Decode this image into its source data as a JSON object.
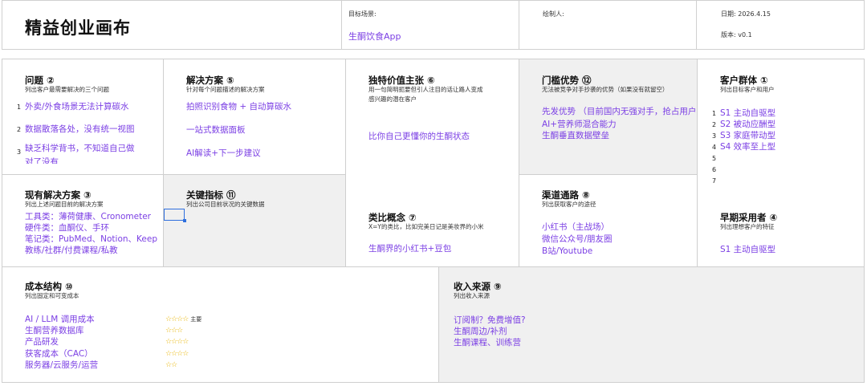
{
  "header": {
    "title": "精益创业画布",
    "target_label": "目标场景:",
    "target_value": "生酮饮食App",
    "author_label": "绘制人:",
    "date_text": "日期:  2026.4.15",
    "version_text": "版本:  v0.1"
  },
  "problem": {
    "title": "问题 ②",
    "subtitle": "列出客户最需要解决的三个问题",
    "items": [
      {
        "num": "1",
        "text": "外卖/外食场景无法计算碳水"
      },
      {
        "num": "2",
        "text": "数据散落各处，没有统一视图"
      },
      {
        "num": "3",
        "text": "缺乏科学背书，不知道自己做"
      },
      {
        "num": "",
        "text": "对了没有"
      }
    ]
  },
  "existing": {
    "title": "现有解决方案 ③",
    "subtitle": "列出上述问题目前的解决方案",
    "items": [
      "工具类：薄荷健康、Cronometer",
      "硬件类：血酮仪、手环",
      "笔记类：PubMed、Notion、Keep",
      "教练/社群/付费课程/私教"
    ]
  },
  "solution": {
    "title": "解决方案 ⑤",
    "subtitle": "针对每个问题描述的解决方案",
    "items": [
      "拍照识别食物 + 自动算碳水",
      "一站式数据面板",
      "AI解读+下一步建议"
    ]
  },
  "metrics": {
    "title": "关键指标 ⑪",
    "subtitle": "列出公司目前状况的关键数据"
  },
  "uvp": {
    "title": "独特价值主张 ⑥",
    "subtitle_1": "用一句简明扼要但引人注目的话让路人变成",
    "subtitle_2": "感兴趣的潜在客户",
    "value": "比你自己更懂你的生酮状态"
  },
  "analogy": {
    "title": "类比概念 ⑦",
    "subtitle": "X=Y的类比，比如完美日记是美妆界的小米",
    "value": "生酮界的小红书+豆包"
  },
  "advantage": {
    "title": "门槛优势 ⑫",
    "subtitle": "无法被竞争对手抄袭的优势（如果没有就留空）",
    "items": [
      "先发优势 （目前国内无强对手，抢占用户",
      "AI+营养师混合能力",
      "生酮垂直数据壁垒"
    ]
  },
  "channels": {
    "title": "渠道通路 ⑧",
    "subtitle": "列出获取客户的途径",
    "items": [
      "小红书（主战场）",
      "微信公众号/朋友圈",
      "B站/Youtube"
    ]
  },
  "segments": {
    "title": "客户群体 ①",
    "subtitle": "列出目标客户和用户",
    "items": [
      {
        "num": "1",
        "text": "S1 主动自驱型"
      },
      {
        "num": "2",
        "text": "S2 被动应酬型"
      },
      {
        "num": "3",
        "text": "S3 家庭带动型"
      },
      {
        "num": "4",
        "text": "S4 效率至上型"
      },
      {
        "num": "5",
        "text": ""
      },
      {
        "num": "6",
        "text": ""
      },
      {
        "num": "7",
        "text": ""
      }
    ]
  },
  "early": {
    "title": "早期采用者 ④",
    "subtitle": "列出理想客户的特征",
    "value": "S1 主动自驱型"
  },
  "cost": {
    "title": "成本结构 ⑩",
    "subtitle": "列出固定和可变成本",
    "items": [
      {
        "label": "AI / LLM 调用成本",
        "stars": "☆☆☆☆",
        "note": "主要"
      },
      {
        "label": "生酮营养数据库",
        "stars": "☆☆☆",
        "note": ""
      },
      {
        "label": "产品研发",
        "stars": "☆☆☆☆",
        "note": ""
      },
      {
        "label": "获客成本（CAC）",
        "stars": "☆☆☆☆",
        "note": ""
      },
      {
        "label": "服务器/云服务/运营",
        "stars": "☆☆",
        "note": ""
      }
    ],
    "star_color": "#e8b400"
  },
  "revenue": {
    "title": "收入来源 ⑨",
    "subtitle": "列出收入来源",
    "items": [
      "订阅制？免费增值?",
      "生酮周边/补剂",
      "生酮课程、训练营"
    ]
  },
  "colors": {
    "accent": "#7b3fe4",
    "selection": "#2f6fde",
    "gray_cell": "#f0f0f0"
  }
}
